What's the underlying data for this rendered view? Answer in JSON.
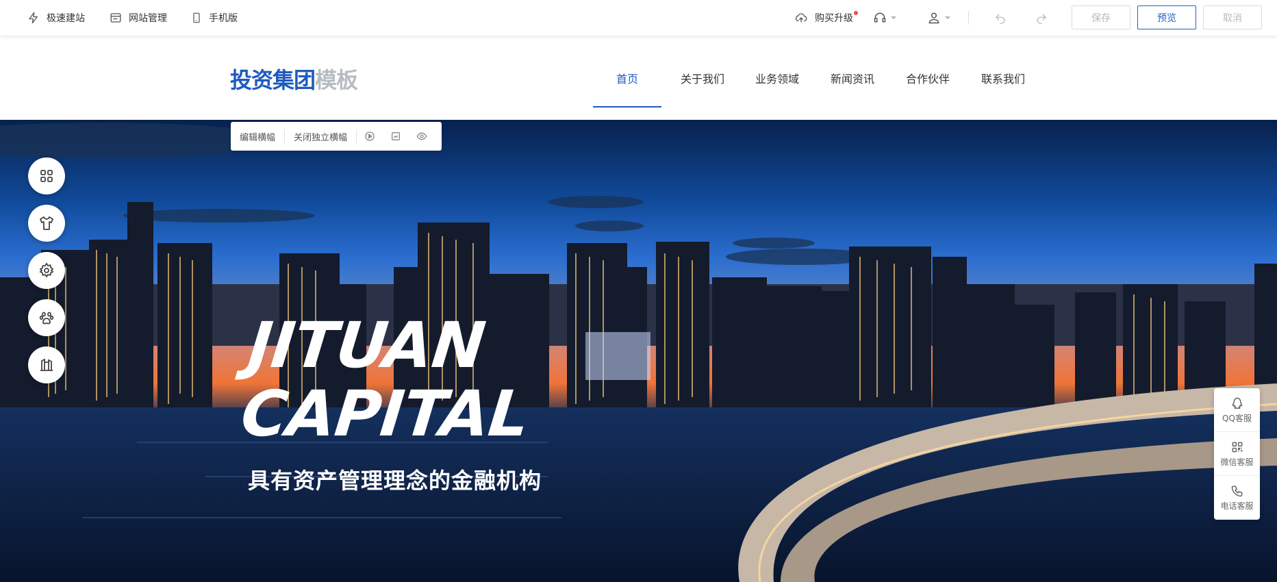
{
  "toolbar": {
    "quick_build": "极速建站",
    "site_manage": "网站管理",
    "mobile": "手机版",
    "upgrade": "购买升级",
    "save": "保存",
    "preview": "预览",
    "cancel": "取消"
  },
  "site": {
    "logo_main": "投资集团",
    "logo_sub": "模板",
    "nav": [
      "首页",
      "关于我们",
      "业务领域",
      "新闻资讯",
      "合作伙伴",
      "联系我们"
    ]
  },
  "banner_tools": {
    "edit": "编辑横幅",
    "close_independent": "关闭独立横幅"
  },
  "hero": {
    "title_line1": "JITUAN",
    "title_line2": "CAPITAL",
    "subtitle": "具有资产管理理念的金融机构"
  },
  "service": {
    "qq": "QQ客服",
    "wechat": "微信客服",
    "phone": "电话客服"
  },
  "colors": {
    "brand": "#1f5bbd",
    "logo_sub": "#b8bcc3",
    "upgrade_dot": "#f24b3c"
  }
}
